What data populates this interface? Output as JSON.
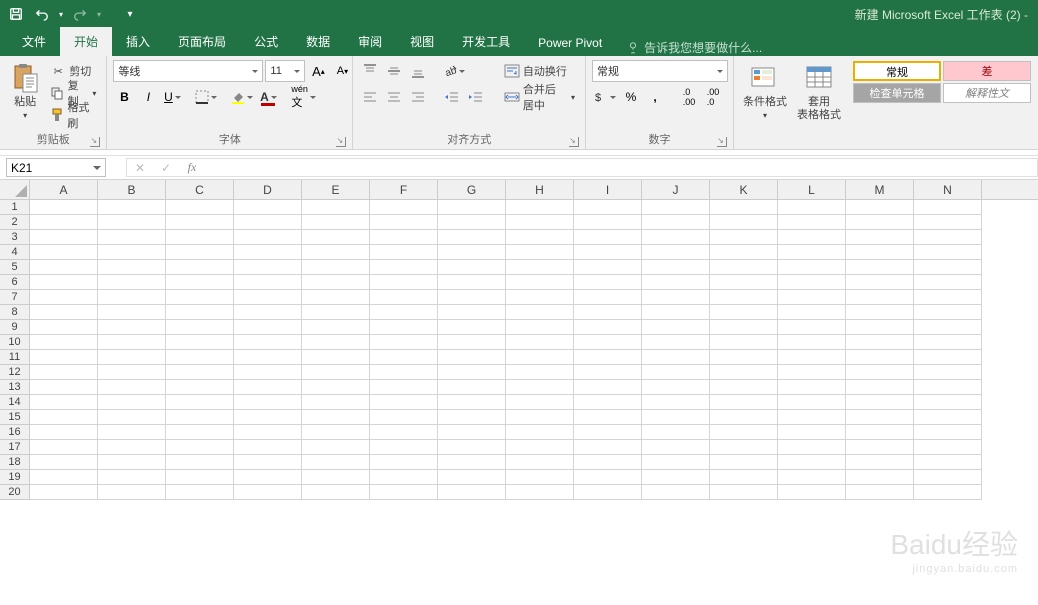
{
  "title": "新建 Microsoft Excel 工作表 (2) -",
  "tabs": {
    "file": "文件",
    "home": "开始",
    "insert": "插入",
    "layout": "页面布局",
    "formulas": "公式",
    "data": "数据",
    "review": "审阅",
    "view": "视图",
    "developer": "开发工具",
    "powerpivot": "Power Pivot"
  },
  "tellme": "告诉我您想要做什么...",
  "ribbon": {
    "clipboard": {
      "paste": "粘贴",
      "cut": "剪切",
      "copy": "复制",
      "format_painter": "格式刷",
      "label": "剪贴板"
    },
    "font": {
      "name": "等线",
      "size": "11",
      "label": "字体"
    },
    "alignment": {
      "wrap": "自动换行",
      "merge": "合并后居中",
      "label": "对齐方式"
    },
    "number": {
      "format": "常规",
      "label": "数字"
    },
    "styles": {
      "cond": "条件格式",
      "table": "套用\n表格格式",
      "s_normal": "常规",
      "s_bad": "差",
      "s_check": "检查单元格",
      "s_explain": "解释性文"
    }
  },
  "namebox": "K21",
  "fx": "fx",
  "columns": [
    "A",
    "B",
    "C",
    "D",
    "E",
    "F",
    "G",
    "H",
    "I",
    "J",
    "K",
    "L",
    "M",
    "N"
  ],
  "rows": [
    "1",
    "2",
    "3",
    "4",
    "5",
    "6",
    "7",
    "8",
    "9",
    "10",
    "11",
    "12",
    "13",
    "14",
    "15",
    "16",
    "17",
    "18",
    "19",
    "20"
  ],
  "watermark": {
    "main": "Baidu经验",
    "sub": "jingyan.baidu.com"
  }
}
